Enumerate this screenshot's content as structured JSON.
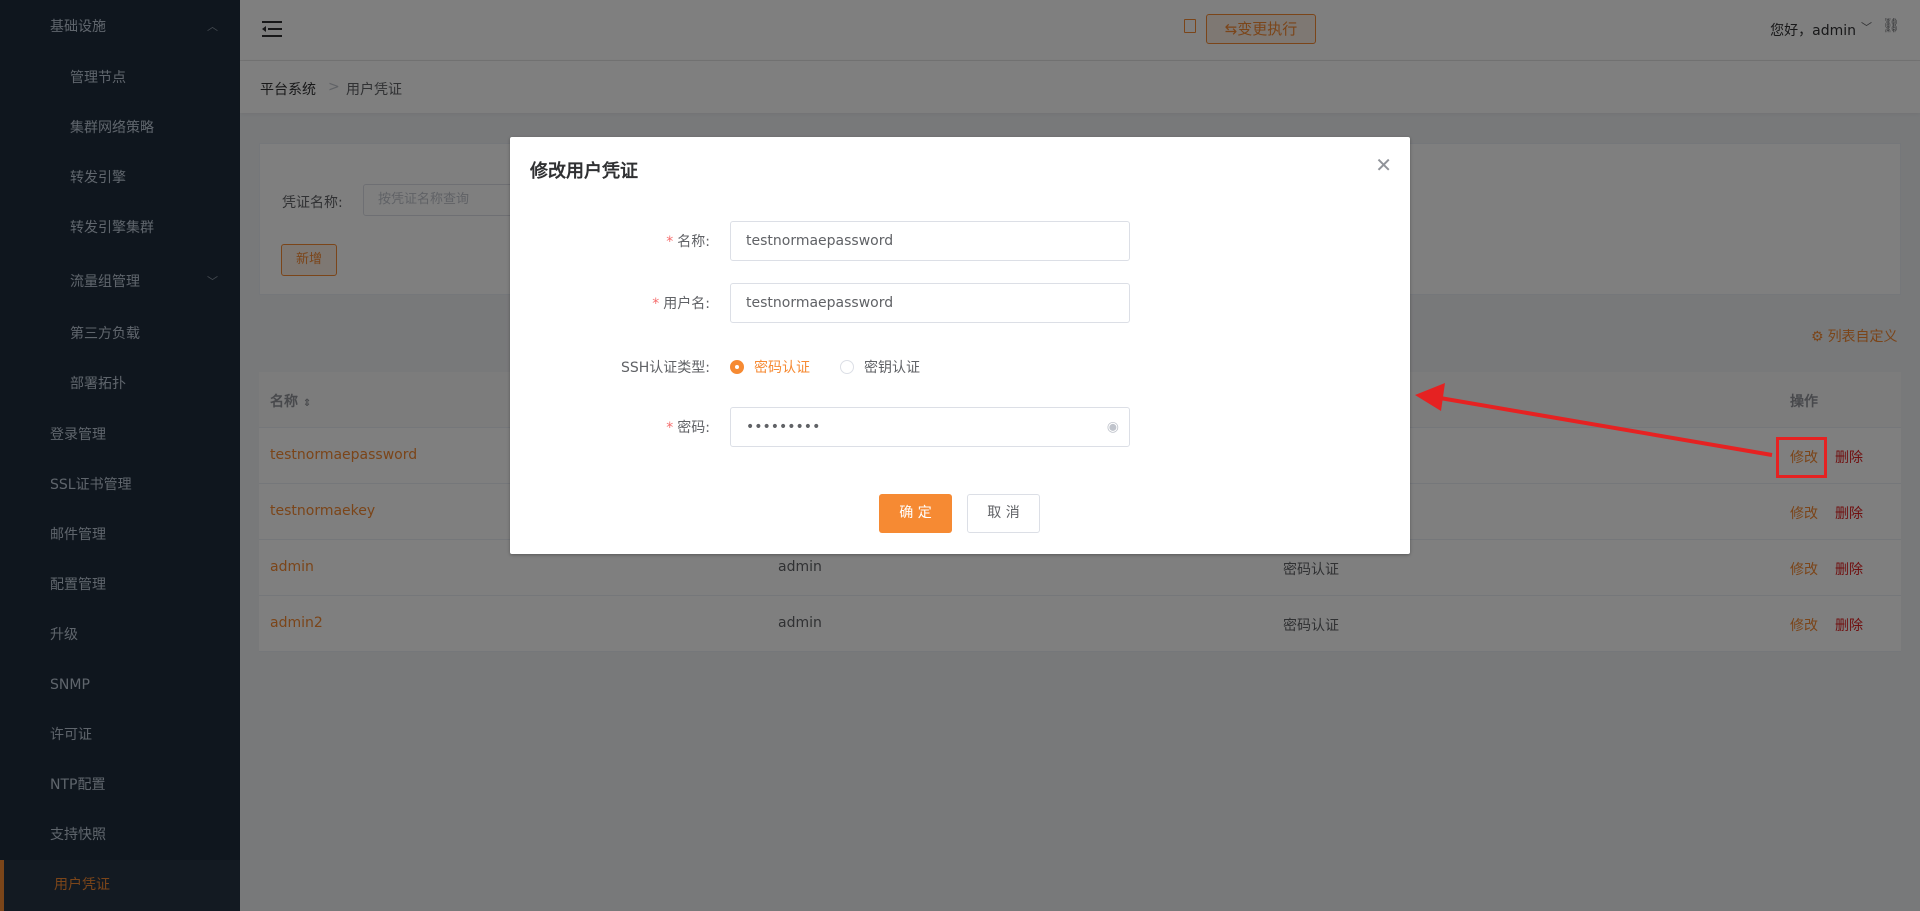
{
  "sidebar": {
    "items": [
      {
        "label": "基础设施",
        "level": 1,
        "expanded": true
      },
      {
        "label": "管理节点",
        "level": 2
      },
      {
        "label": "集群网络策略",
        "level": 2
      },
      {
        "label": "转发引擎",
        "level": 2
      },
      {
        "label": "转发引擎集群",
        "level": 2
      },
      {
        "label": "流量组管理",
        "level": 2,
        "collapsible": true
      },
      {
        "label": "第三方负载",
        "level": 2
      },
      {
        "label": "部署拓扑",
        "level": 2
      },
      {
        "label": "登录管理",
        "level": 1
      },
      {
        "label": "SSL证书管理",
        "level": 1
      },
      {
        "label": "邮件管理",
        "level": 1
      },
      {
        "label": "配置管理",
        "level": 1
      },
      {
        "label": "升级",
        "level": 1
      },
      {
        "label": "SNMP",
        "level": 1
      },
      {
        "label": "许可证",
        "level": 1
      },
      {
        "label": "NTP配置",
        "level": 1
      },
      {
        "label": "支持快照",
        "level": 1
      },
      {
        "label": "用户凭证",
        "level": 1,
        "active": true
      }
    ]
  },
  "header": {
    "exec_label": "变更执行",
    "greeting": "您好，admin"
  },
  "breadcrumb": {
    "root": "平台系统",
    "separator": ">",
    "current": "用户凭证"
  },
  "search": {
    "label": "凭证名称:",
    "placeholder": "按凭证名称查询",
    "add_label": "新增"
  },
  "table": {
    "customize_label": "列表自定义",
    "columns": {
      "name": "名称",
      "ops": "操作"
    },
    "rows": [
      {
        "name": "testnormaepassword",
        "user": "",
        "auth": "",
        "edit": "修改",
        "del": "删除"
      },
      {
        "name": "testnormaekey",
        "user": "",
        "auth": "",
        "edit": "修改",
        "del": "删除"
      },
      {
        "name": "admin",
        "user": "admin",
        "auth": "密码认证",
        "edit": "修改",
        "del": "删除"
      },
      {
        "name": "admin2",
        "user": "admin",
        "auth": "密码认证",
        "edit": "修改",
        "del": "删除"
      }
    ]
  },
  "dialog": {
    "title": "修改用户凭证",
    "fields": {
      "name_label": "名称:",
      "name_value": "testnormaepassword",
      "username_label": "用户名:",
      "username_value": "testnormaepassword",
      "ssh_label": "SSH认证类型:",
      "ssh_options": [
        "密码认证",
        "密钥认证"
      ],
      "ssh_selected": "密码认证",
      "password_label": "密码:",
      "password_value": "•••••••••"
    },
    "ok_label": "确 定",
    "cancel_label": "取 消"
  },
  "colors": {
    "accent": "#f68a33",
    "danger": "#e02020",
    "sidebar_bg": "#1f2d3d",
    "annotation": "#e52222"
  }
}
